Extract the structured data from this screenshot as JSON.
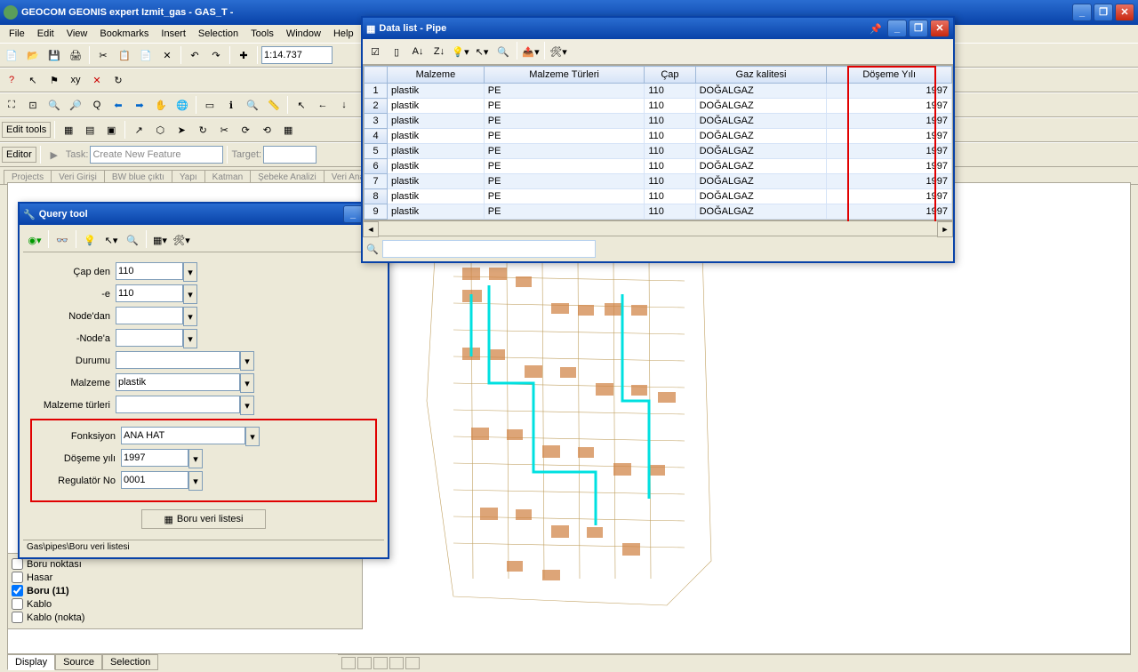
{
  "app_title": "GEOCOM GEONIS expert Izmit_gas - GAS_T -",
  "menus": [
    "File",
    "Edit",
    "View",
    "Bookmarks",
    "Insert",
    "Selection",
    "Tools",
    "Window",
    "Help"
  ],
  "scale": "1:14.737",
  "edit_tools_label": "Edit tools",
  "editor_label": "Editor",
  "task_label": "Task:",
  "task_value": "Create New Feature",
  "target_label": "Target:",
  "project_tabs": [
    "Projects",
    "Veri Girişi",
    "BW blue çıktı",
    "Yapı",
    "Katman",
    "Şebeke Analizi",
    "Veri Analizi"
  ],
  "query": {
    "title": "Query tool",
    "fields": {
      "cap_den": {
        "label": "Çap den",
        "value": "110"
      },
      "e": {
        "label": "-e",
        "value": "110"
      },
      "nodedan": {
        "label": "Node'dan",
        "value": ""
      },
      "nodea": {
        "label": "-Node'a",
        "value": ""
      },
      "durumu": {
        "label": "Durumu",
        "value": ""
      },
      "malzeme": {
        "label": "Malzeme",
        "value": "plastik"
      },
      "malzeme_tur": {
        "label": "Malzeme türleri",
        "value": ""
      },
      "fonksiyon": {
        "label": "Fonksiyon",
        "value": "ANA HAT"
      },
      "doseme": {
        "label": "Döşeme yılı",
        "value": "1997"
      },
      "regulator": {
        "label": "Regulatör No",
        "value": "0001"
      }
    },
    "button": "Boru veri listesi",
    "path": "Gas\\pipes\\Boru veri listesi"
  },
  "legend_items": [
    {
      "label": "Boru noktası",
      "checked": false,
      "bold": false
    },
    {
      "label": "Hasar",
      "checked": false,
      "bold": false
    },
    {
      "label": "Boru (11)",
      "checked": true,
      "bold": true
    },
    {
      "label": "Kablo",
      "checked": false,
      "bold": false
    },
    {
      "label": "Kablo (nokta)",
      "checked": false,
      "bold": false
    }
  ],
  "data_list": {
    "title": "Data list - Pipe",
    "columns": [
      "Malzeme",
      "Malzeme Türleri",
      "Çap",
      "Gaz kalitesi",
      "Döşeme Yılı"
    ],
    "rows": [
      [
        "plastik",
        "PE",
        "110",
        "DOĞALGAZ",
        "1997"
      ],
      [
        "plastik",
        "PE",
        "110",
        "DOĞALGAZ",
        "1997"
      ],
      [
        "plastik",
        "PE",
        "110",
        "DOĞALGAZ",
        "1997"
      ],
      [
        "plastik",
        "PE",
        "110",
        "DOĞALGAZ",
        "1997"
      ],
      [
        "plastik",
        "PE",
        "110",
        "DOĞALGAZ",
        "1997"
      ],
      [
        "plastik",
        "PE",
        "110",
        "DOĞALGAZ",
        "1997"
      ],
      [
        "plastik",
        "PE",
        "110",
        "DOĞALGAZ",
        "1997"
      ],
      [
        "plastik",
        "PE",
        "110",
        "DOĞALGAZ",
        "1997"
      ],
      [
        "plastik",
        "PE",
        "110",
        "DOĞALGAZ",
        "1997"
      ]
    ]
  },
  "bottom_tabs": [
    "Display",
    "Source",
    "Selection"
  ],
  "search_placeholder": ""
}
